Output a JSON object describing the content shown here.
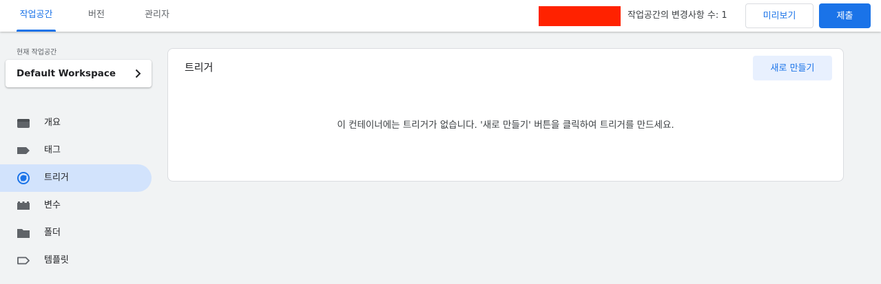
{
  "header": {
    "tabs": [
      {
        "label": "작업공간",
        "active": true
      },
      {
        "label": "버전",
        "active": false
      },
      {
        "label": "관리자",
        "active": false
      }
    ],
    "changes_text": "작업공간의 변경사항 수: 1",
    "preview_label": "미리보기",
    "submit_label": "제출",
    "redacted_color": "#ff2200",
    "accent_color": "#1a73e8"
  },
  "sidebar": {
    "workspace_caption": "현재 작업공간",
    "workspace_name": "Default Workspace",
    "workspace_icon": "chevron-right-icon",
    "items": [
      {
        "label": "개요",
        "icon": "overview-icon",
        "active": false
      },
      {
        "label": "태그",
        "icon": "tag-icon",
        "active": false
      },
      {
        "label": "트리거",
        "icon": "trigger-icon",
        "active": true
      },
      {
        "label": "변수",
        "icon": "variables-icon",
        "active": false
      },
      {
        "label": "폴더",
        "icon": "folder-icon",
        "active": false
      },
      {
        "label": "템플릿",
        "icon": "template-icon",
        "active": false
      }
    ]
  },
  "main": {
    "title": "트리거",
    "new_button_label": "새로 만들기",
    "empty_message": "이 컨테이너에는 트리거가 없습니다. '새로 만들기' 버튼을 클릭하여 트리거를 만드세요."
  }
}
